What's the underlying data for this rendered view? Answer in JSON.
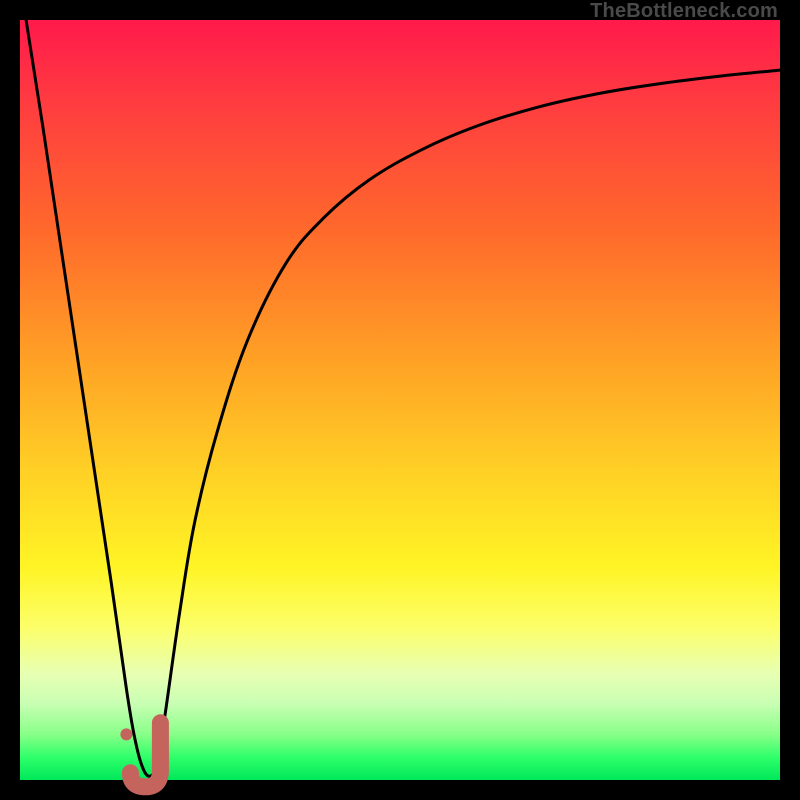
{
  "watermark": "TheBottleneck.com",
  "colors": {
    "frame": "#000000",
    "curve": "#000000",
    "marker": "#c5635d"
  },
  "chart_data": {
    "type": "line",
    "title": "",
    "xlabel": "",
    "ylabel": "",
    "xlim": [
      0,
      100
    ],
    "ylim": [
      0,
      100
    ],
    "grid": false,
    "legend": false,
    "series": [
      {
        "name": "bottleneck-curve",
        "x": [
          0.8,
          3,
          6,
          9,
          12,
          14,
          15,
          16,
          17,
          18,
          19,
          21,
          23,
          26,
          30,
          35,
          40,
          46,
          53,
          60,
          68,
          76,
          84,
          92,
          100
        ],
        "y": [
          100,
          86,
          66,
          46,
          26,
          12,
          6,
          2,
          0.5,
          2,
          8,
          22,
          34,
          46,
          58,
          68,
          74,
          79,
          83,
          86,
          88.5,
          90.3,
          91.6,
          92.6,
          93.4
        ]
      }
    ],
    "marker": {
      "name": "j-marker",
      "x": 16.5,
      "y": 2,
      "symbol": "J",
      "dot": {
        "x": 14,
        "y": 6
      }
    }
  }
}
